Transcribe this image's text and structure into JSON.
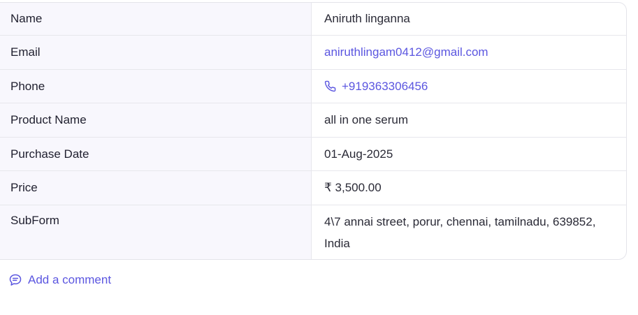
{
  "details": {
    "rows": [
      {
        "label": "Name",
        "value": "Aniruth linganna"
      },
      {
        "label": "Email",
        "value": "aniruthlingam0412@gmail.com"
      },
      {
        "label": "Phone",
        "value": "+919363306456",
        "icon": "phone-icon"
      },
      {
        "label": "Product Name",
        "value": "all in one serum"
      },
      {
        "label": "Purchase Date",
        "value": "01-Aug-2025"
      },
      {
        "label": "Price",
        "value": "₹ 3,500.00"
      },
      {
        "label": "SubForm",
        "value": "4\\7 annai street, porur, chennai, tamilnadu, 639852, India"
      }
    ]
  },
  "comment": {
    "label": "Add a comment",
    "icon": "comment-icon"
  },
  "colors": {
    "accent": "#5b56e0",
    "label_bg": "#f8f7fd",
    "border": "#e7e7ec"
  }
}
